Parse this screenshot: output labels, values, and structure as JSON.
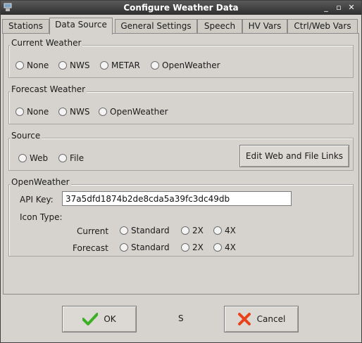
{
  "window": {
    "title": "Configure Weather Data"
  },
  "tabs": [
    {
      "label": "Stations"
    },
    {
      "label": "Data Source"
    },
    {
      "label": "General Settings"
    },
    {
      "label": "Speech"
    },
    {
      "label": "HV Vars"
    },
    {
      "label": "Ctrl/Web Vars"
    }
  ],
  "current_weather": {
    "title": "Current Weather",
    "options": [
      "None",
      "NWS",
      "METAR",
      "OpenWeather"
    ]
  },
  "forecast_weather": {
    "title": "Forecast Weather",
    "options": [
      "None",
      "NWS",
      "OpenWeather"
    ]
  },
  "source": {
    "title": "Source",
    "options": [
      "Web",
      "File"
    ],
    "edit_button": "Edit Web and File Links"
  },
  "openweather": {
    "title": "OpenWeather",
    "api_key_label": "API Key:",
    "api_key_value": "37a5dfd1874b2de8cda5a39fc3dc49db",
    "icon_type_label": "Icon Type:",
    "current_label": "Current",
    "forecast_label": "Forecast",
    "icon_options": [
      "Standard",
      "2X",
      "4X"
    ]
  },
  "footer": {
    "ok_label": "OK",
    "middle_text": "S",
    "cancel_label": "Cancel"
  }
}
